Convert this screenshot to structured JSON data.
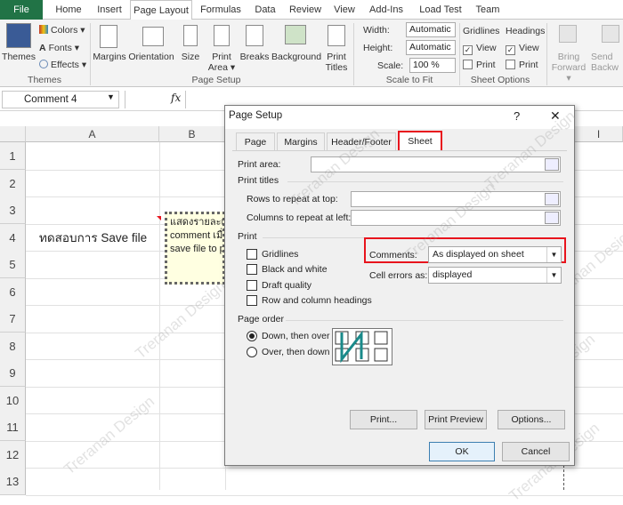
{
  "tabs": [
    "File",
    "Home",
    "Insert",
    "Page Layout",
    "Formulas",
    "Data",
    "Review",
    "View",
    "Add-Ins",
    "Load Test",
    "Team"
  ],
  "ribbon": {
    "themes": {
      "label": "Themes",
      "colors": "Colors",
      "fonts": "Fonts",
      "effects": "Effects",
      "group": "Themes"
    },
    "page_setup": {
      "margins": "Margins",
      "orientation": "Orientation",
      "size": "Size",
      "print_area_1": "Print",
      "print_area_2": "Area",
      "breaks": "Breaks",
      "background": "Background",
      "print_titles_1": "Print",
      "print_titles_2": "Titles",
      "group": "Page Setup"
    },
    "scale": {
      "width_label": "Width:",
      "width_value": "Automatic",
      "height_label": "Height:",
      "height_value": "Automatic",
      "scale_label": "Scale:",
      "scale_value": "100 %",
      "group": "Scale to Fit"
    },
    "sheet_options": {
      "gridlines": "Gridlines",
      "headings": "Headings",
      "view": "View",
      "print": "Print",
      "group": "Sheet Options"
    },
    "arrange": {
      "bring_1": "Bring",
      "bring_2": "Forward",
      "send_1": "Send",
      "send_2": "Backw"
    }
  },
  "formula_bar": {
    "name_box": "Comment 4",
    "fx": "fx"
  },
  "sheet": {
    "columns": [
      "A",
      "B",
      "I"
    ],
    "rows": [
      "1",
      "2",
      "3",
      "4",
      "5",
      "6",
      "7",
      "8",
      "9",
      "10",
      "11",
      "12",
      "13"
    ],
    "cell_a4": "ทดสอบการ Save file",
    "comment_lines": [
      "แสดงรายละเอี",
      "comment เมื่",
      "save file to p"
    ]
  },
  "dialog": {
    "title": "Page Setup",
    "help": "?",
    "close": "✕",
    "tabs": [
      "Page",
      "Margins",
      "Header/Footer",
      "Sheet"
    ],
    "print_area_label": "Print area:",
    "print_titles_label": "Print titles",
    "rows_repeat_label": "Rows to repeat at top:",
    "cols_repeat_label": "Columns to repeat at left:",
    "print_section": "Print",
    "gridlines": "Gridlines",
    "black_white": "Black and white",
    "draft_quality": "Draft quality",
    "row_col_headings": "Row and column headings",
    "comments_label": "Comments:",
    "comments_value": "As displayed on sheet",
    "cell_errors_label": "Cell errors as:",
    "cell_errors_value": "displayed",
    "page_order": "Page order",
    "down_then_over": "Down, then over",
    "over_then_down": "Over, then down",
    "print_btn": "Print...",
    "preview_btn": "Print Preview",
    "options_btn": "Options...",
    "ok_btn": "OK",
    "cancel_btn": "Cancel"
  },
  "watermark": "Treranan Design",
  "colors": {
    "file_tab": "#217346",
    "highlight": "#e8141d",
    "ok_border": "#3c7fb1"
  }
}
